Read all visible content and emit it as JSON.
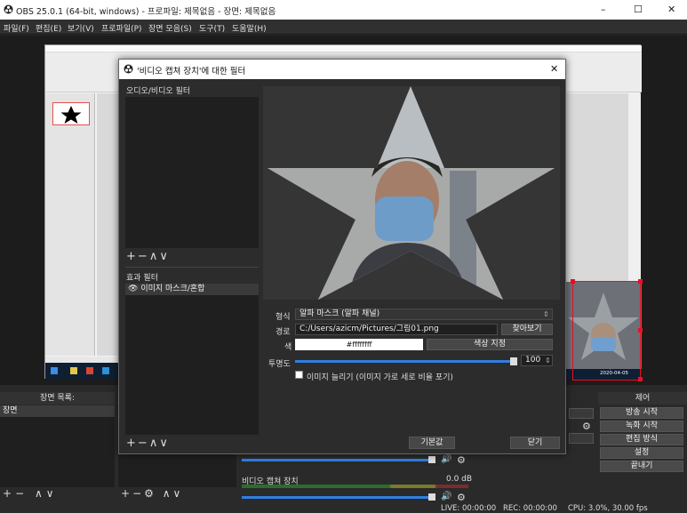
{
  "window": {
    "title": "OBS 25.0.1 (64-bit, windows) - 프로파일: 제목없음 - 장면: 제목없음",
    "minimize_glyph": "–",
    "maximize_glyph": "☐",
    "close_glyph": "✕"
  },
  "menu": [
    "파일(F)",
    "편집(E)",
    "보기(V)",
    "프로파일(P)",
    "장면 모음(S)",
    "도구(T)",
    "도움말(H)"
  ],
  "scenes_dock": {
    "title": "장면 목록:",
    "items": [
      "장면"
    ],
    "footer_icons": [
      "+",
      "−",
      "∧",
      "∨"
    ]
  },
  "sources_dock": {
    "footer_icons": [
      "+",
      "−",
      "⚙",
      "∧",
      "∨"
    ]
  },
  "mixer": {
    "channel_label": "비디오 캡쳐 장치",
    "channel_db": "0.0 dB"
  },
  "controls_dock": {
    "title": "제어",
    "buttons": [
      "방송 시작",
      "녹화 시작",
      "편집 방식",
      "설정",
      "끝내기"
    ]
  },
  "status": {
    "live": "LIVE: 00:00:00",
    "rec": "REC: 00:00:00",
    "cpu": "CPU: 3.0%, 30.00 fps"
  },
  "filters_dialog": {
    "title": "'비디오 캡쳐 장치'에 대한 필터",
    "close_glyph": "✕",
    "audio_video_label": "오디오/비디오 필터",
    "effects_label": "효과 필터",
    "effect_items": [
      "이미지 마스크/혼합"
    ],
    "list_controls": [
      "+",
      "−",
      "∧",
      "∨"
    ],
    "form": {
      "type_label": "형식",
      "type_value": "알파 마스크 (알파 채널)",
      "path_label": "경로",
      "path_value": "C:/Users/azicm/Pictures/그림01.png",
      "browse_button": "찾아보기",
      "color_label": "색",
      "color_value": "#ffffffff",
      "color_button": "색상 지정",
      "opacity_label": "투명도",
      "opacity_value": "100",
      "stretch_label": "이미지 늘리기 (이미지 가로 세로 비율 포기)"
    },
    "defaults_button": "기본값",
    "close_button": "닫기"
  },
  "captured_screen": {
    "calendar_time": "오후 1:06",
    "calendar_date": "2020-04-05"
  },
  "colors": {
    "obs_dark": "#2b2b2b",
    "accent_blue": "#2f7fe0",
    "selection_red": "#e81123",
    "list_bg": "#1f1f1f"
  }
}
